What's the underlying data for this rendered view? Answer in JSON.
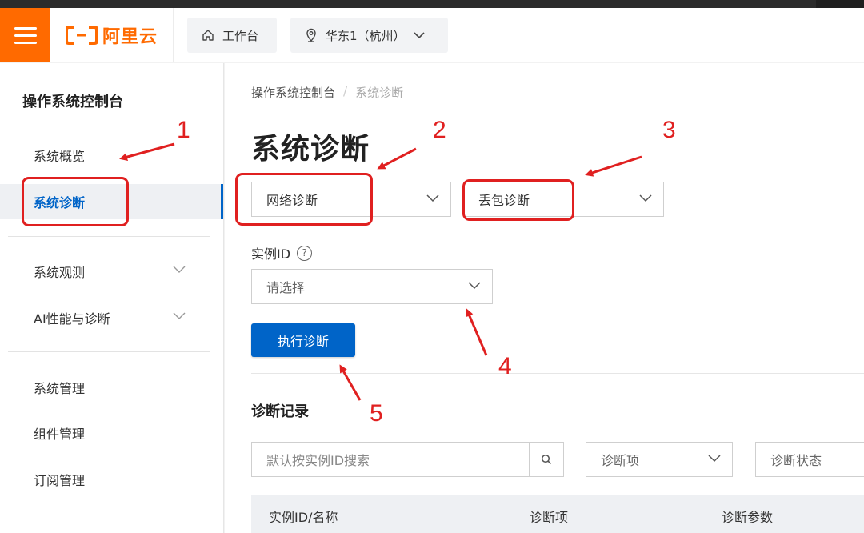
{
  "header": {
    "logo_text": "阿里云",
    "workbench_label": "工作台",
    "region_label": "华东1（杭州）"
  },
  "sidebar": {
    "title": "操作系统控制台",
    "items": [
      {
        "label": "系统概览"
      },
      {
        "label": "系统诊断"
      },
      {
        "label": "系统观测"
      },
      {
        "label": "AI性能与诊断"
      },
      {
        "label": "系统管理"
      },
      {
        "label": "组件管理"
      },
      {
        "label": "订阅管理"
      }
    ]
  },
  "main": {
    "breadcrumb": {
      "parent": "操作系统控制台",
      "current": "系统诊断"
    },
    "title": "系统诊断",
    "diagnosis_type": "网络诊断",
    "diagnosis_subtype": "丢包诊断",
    "instance_label": "实例ID",
    "instance_placeholder": "请选择",
    "run_button": "执行诊断",
    "records_title": "诊断记录",
    "search_placeholder": "默认按实例ID搜索",
    "filter_item": "诊断项",
    "filter_status": "诊断状态",
    "table_headers": [
      "实例ID/名称",
      "诊断项",
      "诊断参数"
    ]
  },
  "annotations": [
    "1",
    "2",
    "3",
    "4",
    "5"
  ],
  "colors": {
    "brand": "#ff6a00",
    "primary": "#0064c8",
    "annotation": "#e02020"
  }
}
